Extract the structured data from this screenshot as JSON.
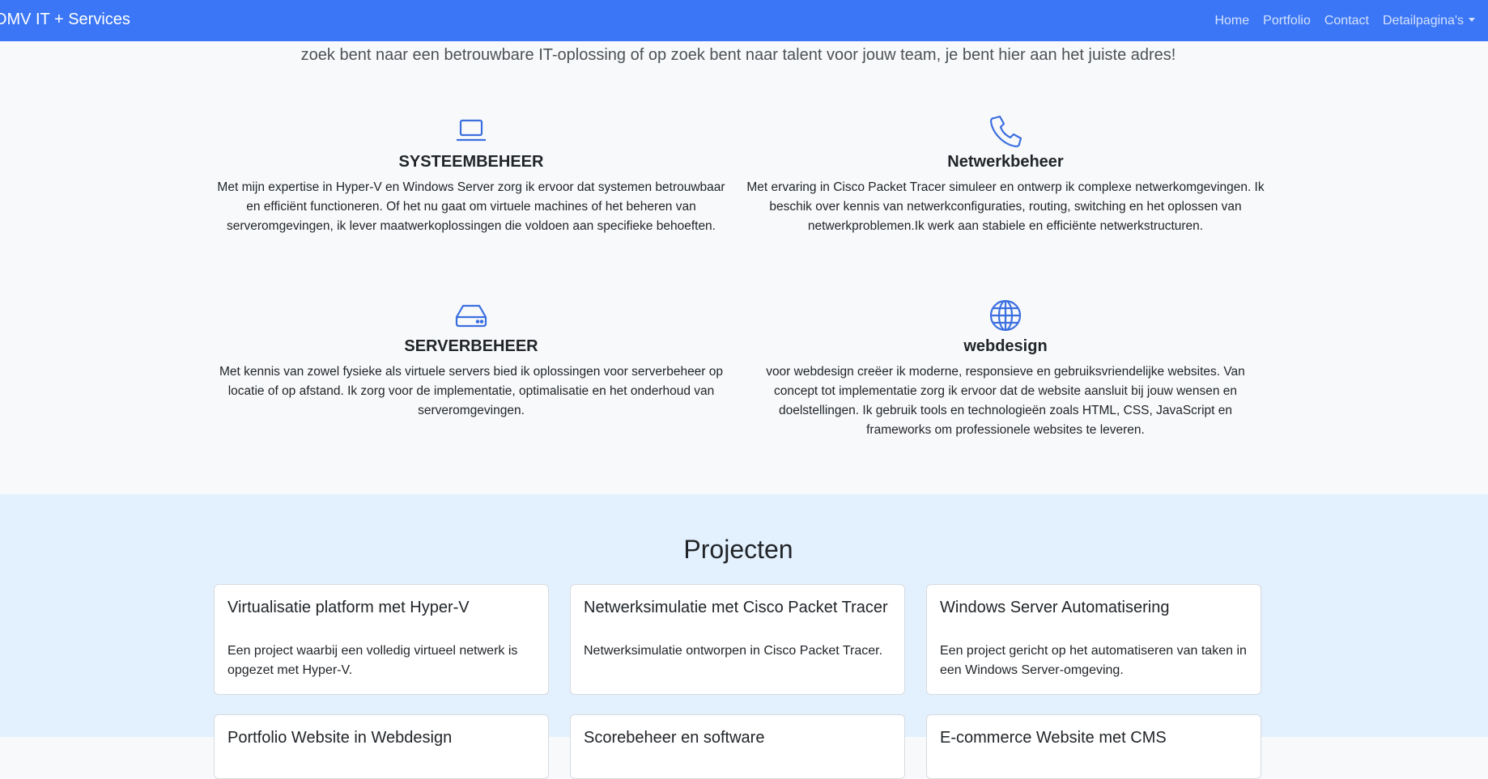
{
  "navbar": {
    "brand": "DMV IT + Services",
    "links": [
      "Home",
      "Portfolio",
      "Contact",
      "Detailpagina's"
    ]
  },
  "intro": "zoek bent naar een betrouwbare IT-oplossing of op zoek bent naar talent voor jouw team, je bent hier aan het juiste adres!",
  "services": [
    {
      "icon": "laptop-icon",
      "title": "SYSTEEMBEHEER",
      "text": "Met mijn expertise in Hyper-V en Windows Server zorg ik ervoor dat systemen betrouwbaar en efficiënt functioneren. Of het nu gaat om virtuele machines of het beheren van serveromgevingen, ik lever maatwerkoplossingen die voldoen aan specifieke behoeften."
    },
    {
      "icon": "phone-icon",
      "title": "Netwerkbeheer",
      "text": "Met ervaring in Cisco Packet Tracer simuleer en ontwerp ik complexe netwerkomgevingen. Ik beschik over kennis van netwerkconfiguraties, routing, switching en het oplossen van netwerkproblemen.Ik werk aan stabiele en efficiënte netwerkstructuren."
    },
    {
      "icon": "hdd-icon",
      "title": "SERVERBEHEER",
      "text": "Met kennis van zowel fysieke als virtuele servers bied ik oplossingen voor serverbeheer op locatie of op afstand. Ik zorg voor de implementatie, optimalisatie en het onderhoud van serveromgevingen."
    },
    {
      "icon": "globe-icon",
      "title": "webdesign",
      "text": "voor webdesign creëer ik moderne, responsieve en gebruiksvriendelijke websites. Van concept tot implementatie zorg ik ervoor dat de website aansluit bij jouw wensen en doelstellingen. Ik gebruik tools en technologieën zoals HTML, CSS, JavaScript en frameworks om professionele websites te leveren."
    }
  ],
  "projects": {
    "heading": "Projecten",
    "cards": [
      {
        "title": "Virtualisatie platform met Hyper-V",
        "text": "Een project waarbij een volledig virtueel netwerk is opgezet met Hyper-V."
      },
      {
        "title": "Netwerksimulatie met Cisco Packet Tracer",
        "text": "Netwerksimulatie ontworpen in Cisco Packet Tracer."
      },
      {
        "title": "Windows Server Automatisering",
        "text": "Een project gericht op het automatiseren van taken in een Windows Server-omgeving."
      },
      {
        "title": "Portfolio Website in Webdesign",
        "text": ""
      },
      {
        "title": "Scorebeheer en software",
        "text": ""
      },
      {
        "title": "E-commerce Website met CMS",
        "text": ""
      }
    ]
  },
  "colors": {
    "navbar": "#3b76f6",
    "icon": "#3b6fe0",
    "services_bg": "#f8f9fa",
    "projects_bg": "#e3f0fd"
  }
}
